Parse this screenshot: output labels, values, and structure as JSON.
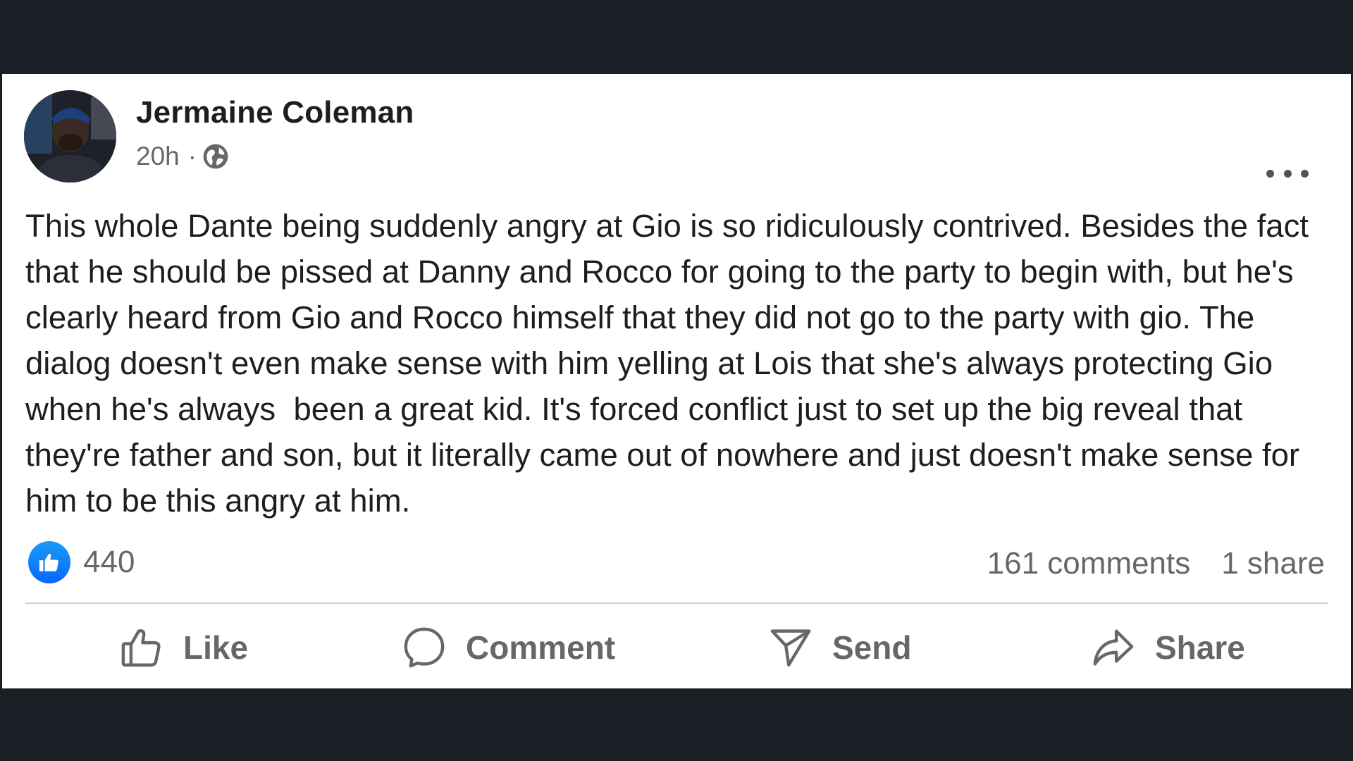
{
  "post": {
    "author": "Jermaine Coleman",
    "time": "20h",
    "separator": "·",
    "privacy_icon": "globe-icon",
    "more_icon": "more-options-icon",
    "body": "This whole Dante being suddenly angry at Gio is so ridiculously contrived. Besides the fact that he should be pissed at Danny and Rocco for going to the party to begin with, but he's clearly heard from Gio and Rocco himself that they did not go to the party with gio. The dialog doesn't even make sense with him yelling at Lois that she's always protecting Gio when he's always  been a great kid. It's forced conflict just to set up the big reveal that they're father and son, but it literally came out of nowhere and just doesn't make sense for him to be this angry at him."
  },
  "stats": {
    "reaction_count": "440",
    "comments": "161 comments",
    "shares": "1 share"
  },
  "actions": {
    "like": "Like",
    "comment": "Comment",
    "send": "Send",
    "share": "Share"
  },
  "colors": {
    "background": "#1a1e25",
    "card": "#ffffff",
    "text_primary": "#1c1e21",
    "text_secondary": "#65676b",
    "like_blue": "#0866ff"
  }
}
